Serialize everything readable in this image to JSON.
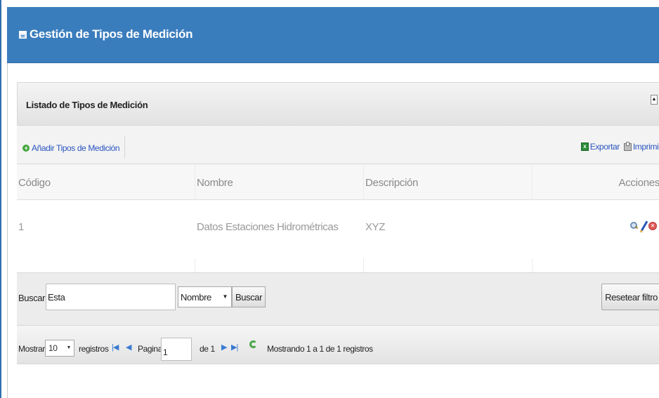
{
  "header": {
    "title": "Gestión de Tipos de Medición"
  },
  "panel": {
    "title": "Listado de Tipos de Medición",
    "collapse_glyph": "▲"
  },
  "toolbar": {
    "add_label": "Añadir Tipos de Medición",
    "export_label": "Exportar",
    "print_label": "Imprimir"
  },
  "table": {
    "columns": [
      "Código",
      "Nombre",
      "Descripción",
      "Acciones"
    ],
    "rows": [
      {
        "codigo": "1",
        "nombre": "Datos Estaciones Hidrométricas",
        "descripcion": "XYZ"
      }
    ]
  },
  "search": {
    "label": "Buscar:",
    "value": "Esta",
    "field_selected": "Nombre",
    "button_label": "Buscar",
    "reset_label": "Resetear filtro"
  },
  "pager": {
    "show_label": "Mostrar",
    "page_size": "10",
    "records_label": "registros",
    "page_label": "Pagina",
    "page_value": "1",
    "of_label": "de 1",
    "status": "Mostrando 1 a 1 de 1 registros"
  },
  "icons": {
    "first_page": "|◀",
    "prev_page": "◀",
    "next_page": "▶",
    "last_page": "▶|"
  }
}
